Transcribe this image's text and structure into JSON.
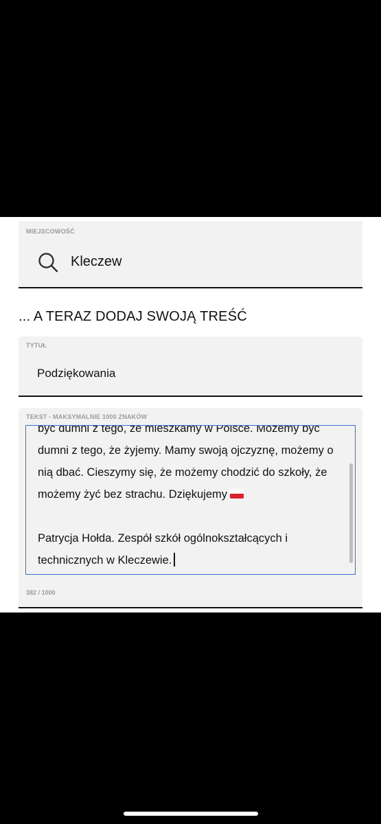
{
  "location": {
    "label": "MIEJSCOWOŚĆ",
    "value": "Kleczew",
    "icon": "search-icon"
  },
  "section": {
    "heading": "... A TERAZ DODAJ SWOJĄ TREŚĆ"
  },
  "title_field": {
    "label": "TYTUŁ",
    "value": "Podziękowania"
  },
  "text_field": {
    "label": "TEKST - MAKSYMALNIE 1000 ZNAKÓW",
    "visible_text_part1": "być dumni z tego, że mieszkamy w Polsce. Możemy być dumni z tego, że żyjemy. Mamy swoją ojczyznę, możemy o nią dbać. Cieszymy się, że możemy chodzić do szkoły, że możemy żyć bez strachu. Dziękujemy",
    "flag_icon": "poland-flag-emoji",
    "visible_text_part2": "\n\nPatrycja Hołda. Zespół szkół ogólnokształcących i technicznych w Kleczewie.",
    "counter": "382 / 1000"
  },
  "colors": {
    "field_bg": "#f2f2f2",
    "focus_border": "#3b6fd6",
    "label_gray": "#9a9a9a"
  }
}
